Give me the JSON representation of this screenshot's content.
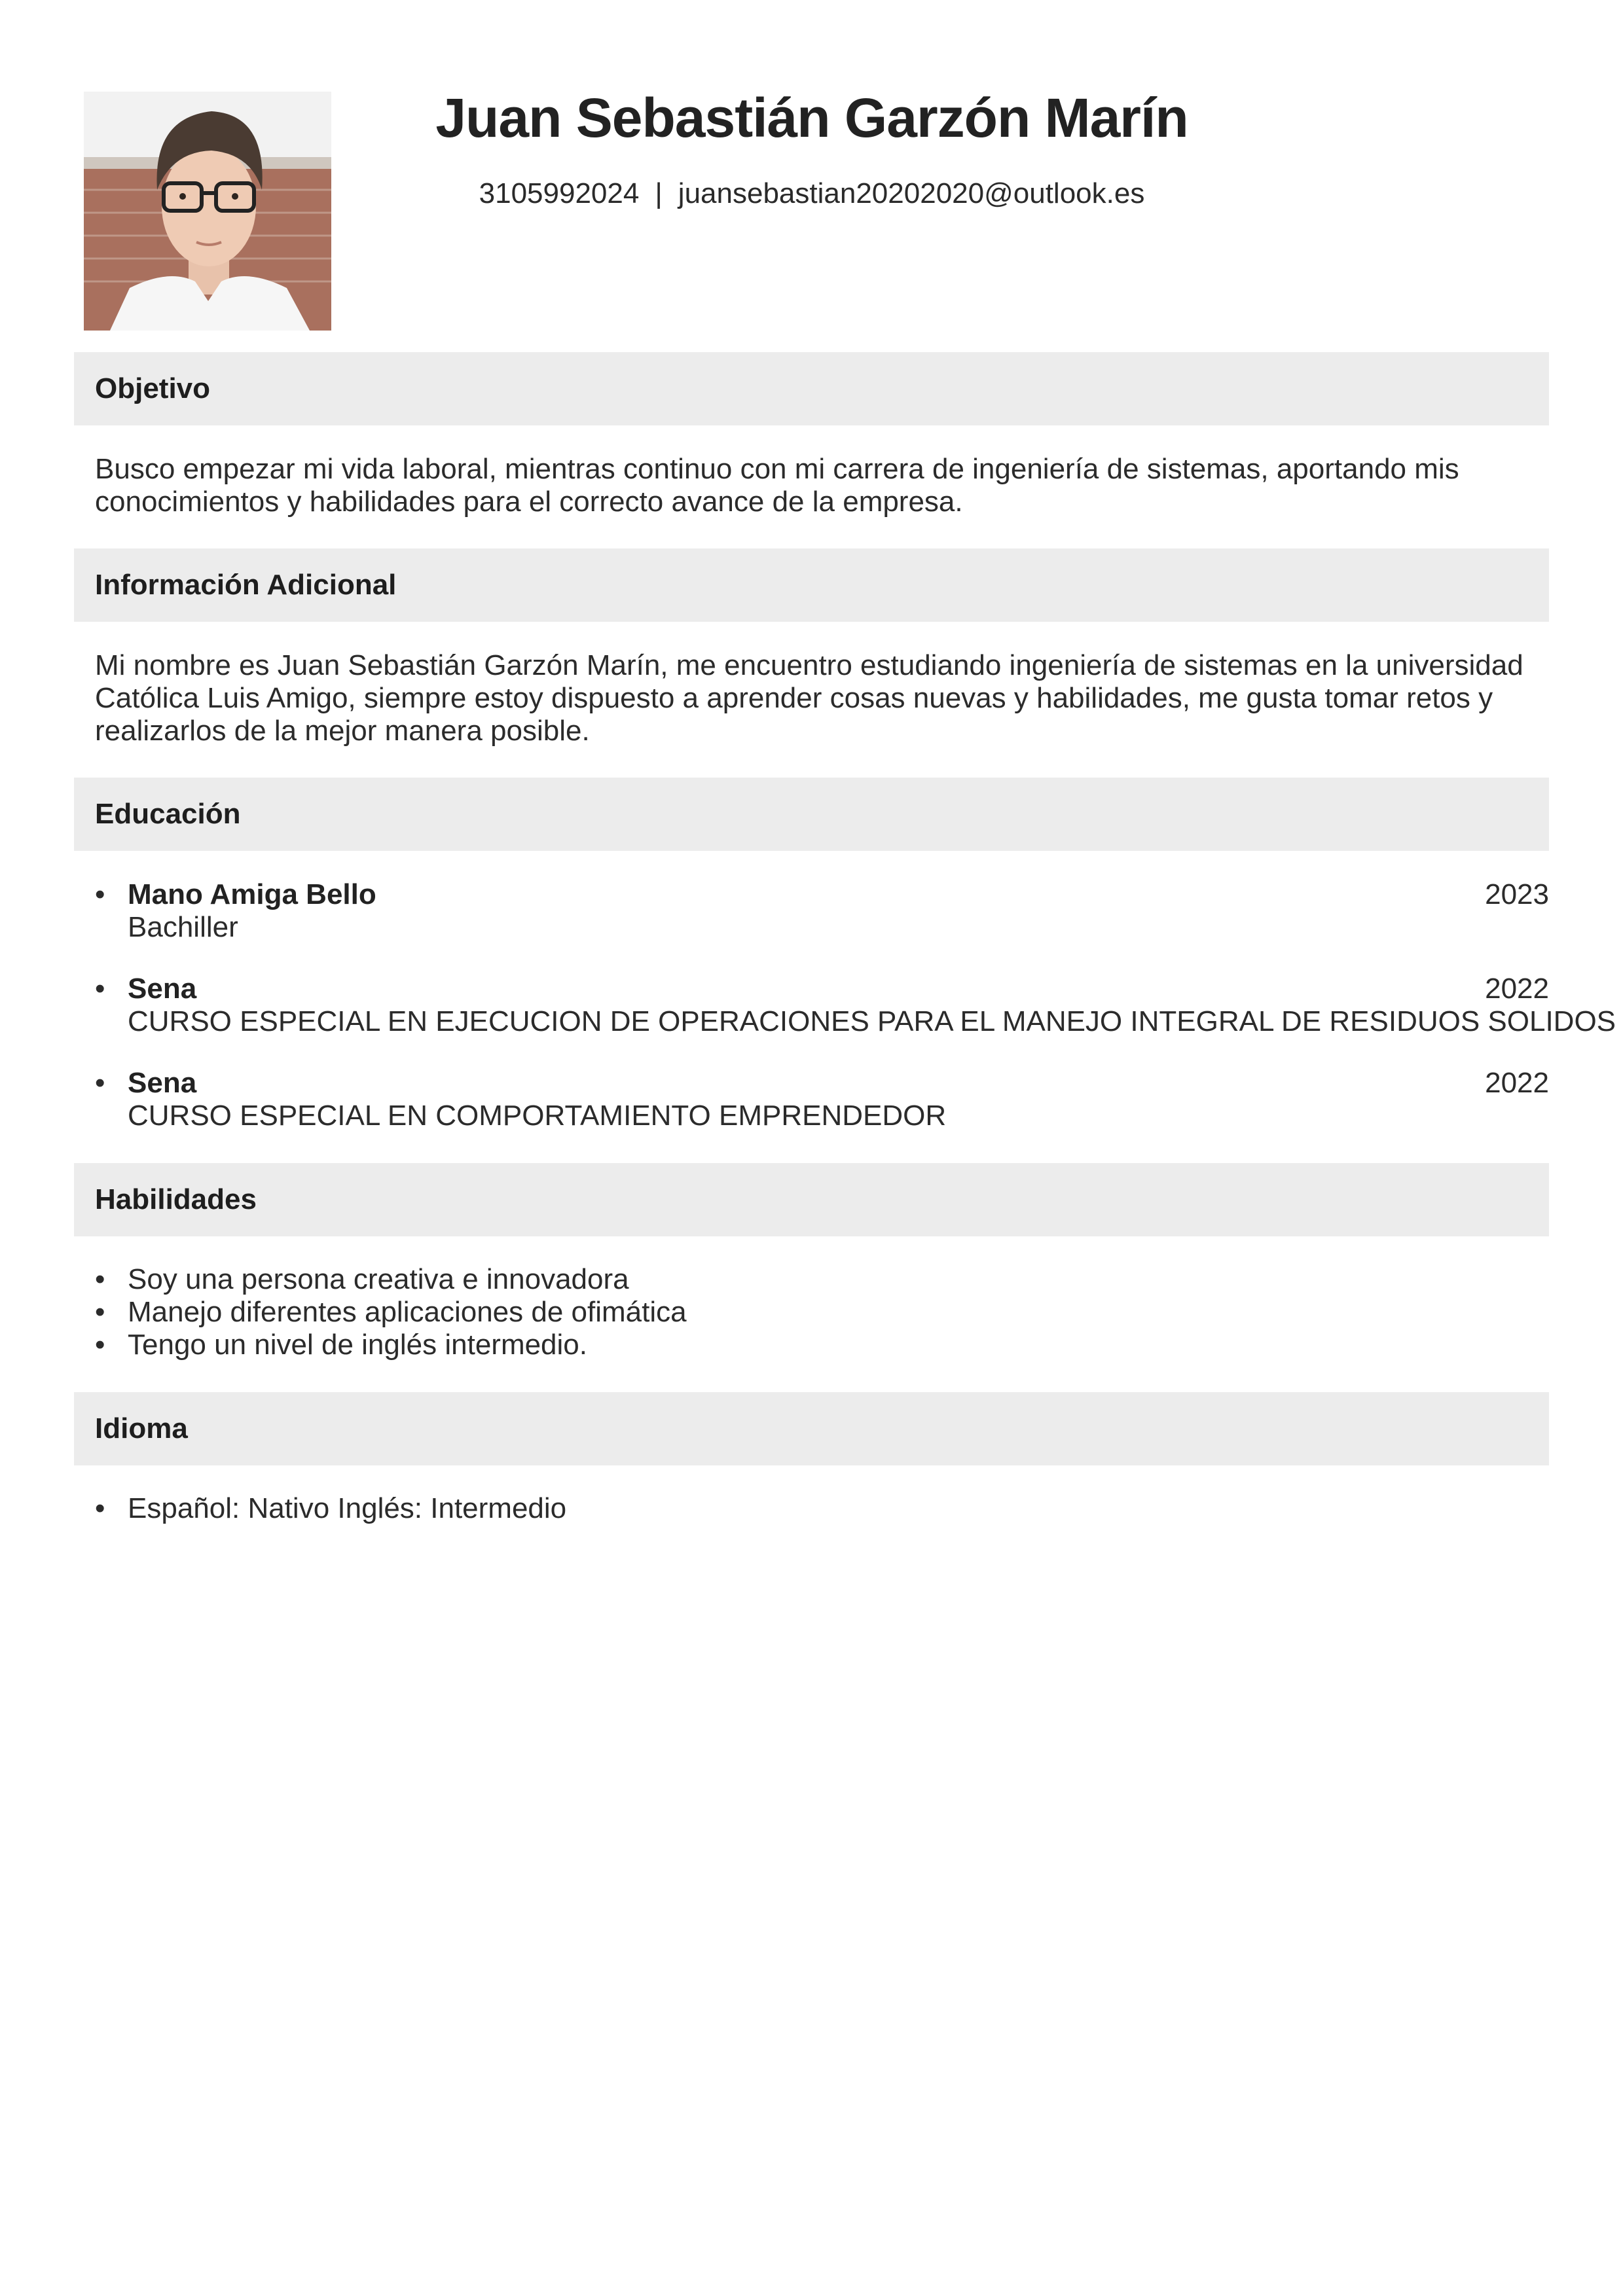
{
  "header": {
    "name": "Juan Sebastián Garzón Marín",
    "phone": "3105992024",
    "separator": "|",
    "email": "juansebastian20202020@outlook.es"
  },
  "sections": {
    "objetivo": {
      "title": "Objetivo",
      "text": "Busco empezar mi vida laboral, mientras continuo con mi carrera de ingeniería de sistemas, aportando mis conocimientos y habilidades para el correcto avance de la empresa."
    },
    "info": {
      "title": "Información Adicional",
      "text": "Mi nombre es Juan Sebastián Garzón Marín, me encuentro estudiando ingeniería de sistemas en la universidad Católica Luis Amigo, siempre estoy dispuesto a aprender cosas nuevas y habilidades, me gusta tomar retos y realizarlos de la mejor manera posible."
    },
    "educacion": {
      "title": "Educación",
      "items": [
        {
          "school": "Mano Amiga Bello",
          "degree": "Bachiller",
          "year": "2023"
        },
        {
          "school": "Sena",
          "degree": "CURSO ESPECIAL EN EJECUCION DE OPERACIONES PARA EL MANEJO INTEGRAL DE RESIDUOS SOLIDOS",
          "year": "2022"
        },
        {
          "school": "Sena",
          "degree": "CURSO ESPECIAL EN COMPORTAMIENTO EMPRENDEDOR",
          "year": "2022"
        }
      ]
    },
    "habilidades": {
      "title": "Habilidades",
      "items": [
        "Soy una persona creativa e innovadora",
        "Manejo diferentes aplicaciones de ofimática",
        "Tengo un nivel de inglés intermedio."
      ]
    },
    "idioma": {
      "title": "Idioma",
      "items": [
        "Español: Nativo Inglés: Intermedio"
      ]
    }
  },
  "bullet": "•"
}
